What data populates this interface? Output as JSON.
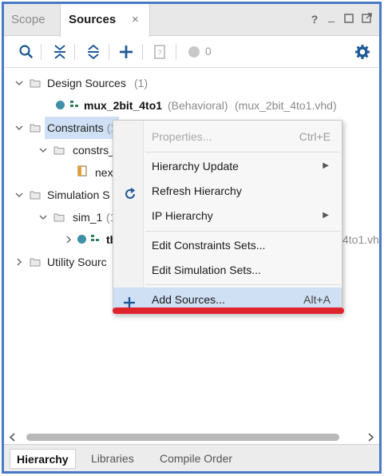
{
  "tabs": {
    "scope": "Scope",
    "sources": "Sources",
    "close": "×",
    "help": "?",
    "minimize": "_"
  },
  "toolbar": {
    "icons": [
      "search-icon",
      "collapse-all-icon",
      "expand-all-icon",
      "add-icon",
      "properties-doc-icon",
      "status-circle-icon",
      "gear-icon"
    ],
    "count": "0"
  },
  "tree": {
    "design_sources": {
      "label": "Design Sources",
      "count": "(1)"
    },
    "design_file": {
      "name": "mux_2bit_4to1",
      "arch": "(Behavioral)",
      "file": "(mux_2bit_4to1.vhd)"
    },
    "constraints": {
      "label": "Constraints",
      "count": "(1"
    },
    "constrs_1": {
      "label": "constrs_"
    },
    "nexys_file": {
      "label": "nexy"
    },
    "simulation_sources": {
      "label": "Simulation S"
    },
    "sim_1": {
      "label": "sim_1",
      "count": "(1"
    },
    "tb_file": {
      "label": "tb",
      "suffix": "4to1.vh"
    },
    "utility_sources": {
      "label": "Utility Sourc"
    }
  },
  "context_menu": {
    "items": [
      {
        "label": "Properties...",
        "shortcut": "Ctrl+E",
        "disabled": true
      },
      {
        "label": "Hierarchy Update",
        "submenu": true
      },
      {
        "label": "Refresh Hierarchy",
        "icon": "refresh-icon"
      },
      {
        "label": "IP Hierarchy",
        "submenu": true
      },
      {
        "label": "Edit Constraints Sets..."
      },
      {
        "label": "Edit Simulation Sets..."
      },
      {
        "label": "Add Sources...",
        "shortcut": "Alt+A",
        "icon": "plus-icon",
        "highlighted": true
      }
    ]
  },
  "bottom_tabs": {
    "hierarchy": "Hierarchy",
    "libraries": "Libraries",
    "compile_order": "Compile Order"
  },
  "colors": {
    "frame_border": "#4a79c7",
    "selection": "#cfe0f5",
    "annotation_red": "#e0242c",
    "status_teal": "#3f8fa8"
  }
}
